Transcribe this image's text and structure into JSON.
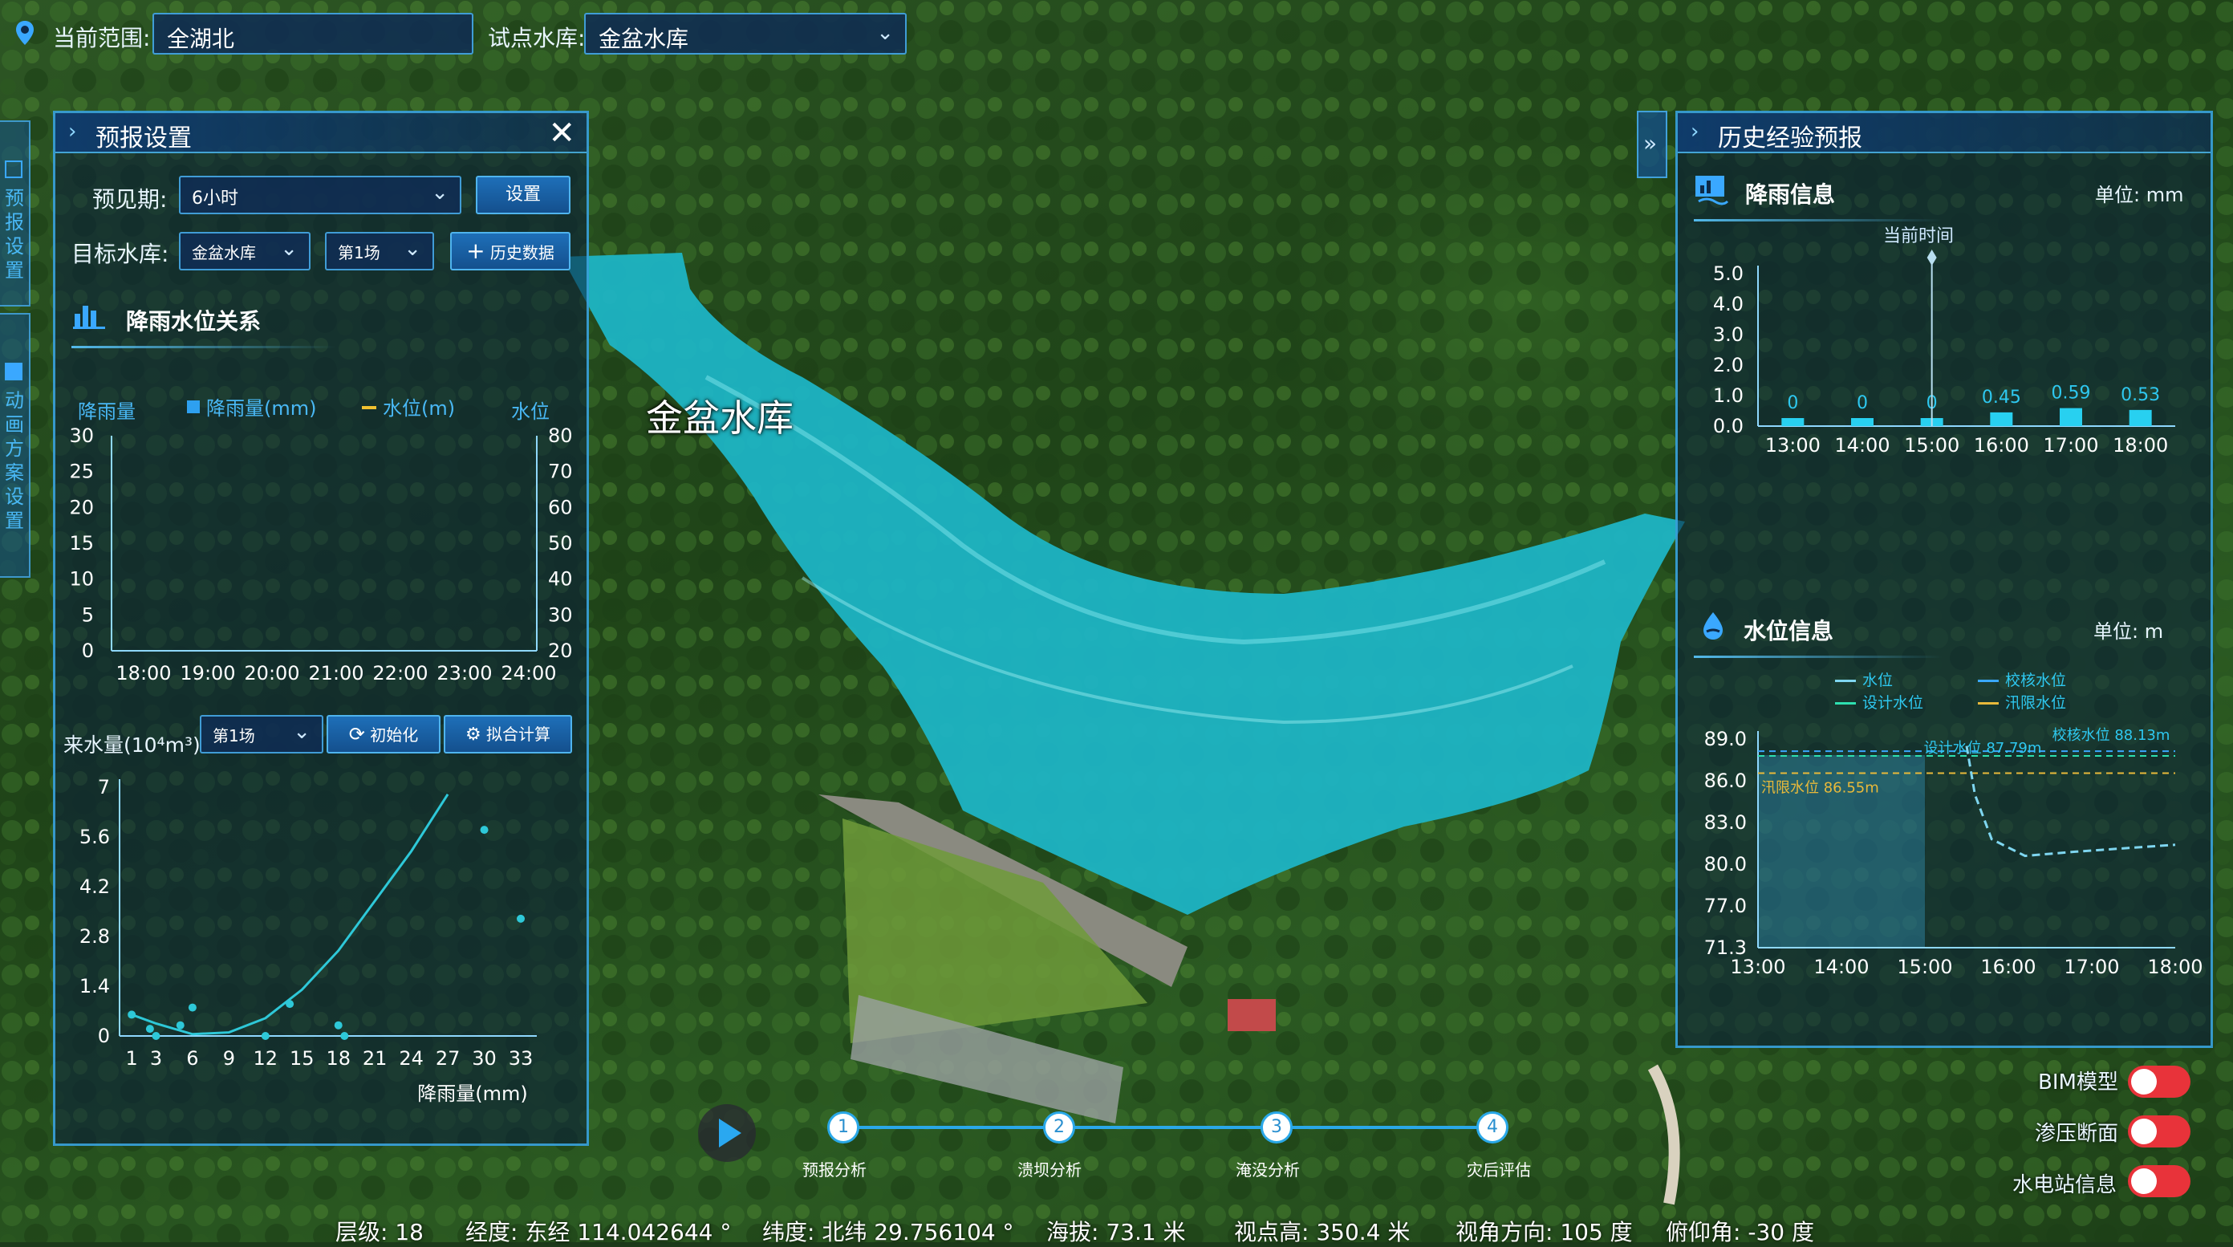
{
  "topbar": {
    "scope_label": "当前范围:",
    "scope_value": "全湖北",
    "reservoir_label": "试点水库:",
    "reservoir_value": "金盆水库"
  },
  "left_tabs": [
    "预报设置",
    "动画方案设置"
  ],
  "map_label": "金盆水库",
  "forecast_panel": {
    "title": "预报设置",
    "period_label": "预见期:",
    "period_value": "6小时",
    "set_button": "设置",
    "target_label": "目标水库:",
    "target_value": "金盆水库",
    "event_value": "第1场",
    "history_button": "历史数据",
    "relation_title": "降雨水位关系",
    "legend_left": "降雨量",
    "legend_rain": "降雨量(mm)",
    "legend_level": "水位(m)",
    "legend_right": "水位",
    "inflow_label": "来水量(10⁴m³)",
    "inflow_event": "第1场",
    "init_button": "初始化",
    "fit_button": "拟合计算",
    "scatter_xlabel": "降雨量(mm)"
  },
  "history_panel": {
    "title": "历史经验预报",
    "rain_title": "降雨信息",
    "rain_unit": "单位: mm",
    "current_time": "当前时间",
    "level_title": "水位信息",
    "level_unit": "单位: m",
    "legend": [
      "水位",
      "校核水位",
      "设计水位",
      "汛限水位"
    ],
    "design_label": "设计水位 87.79m",
    "check_label": "校核水位 88.13m",
    "flood_label": "汛限水位 86.55m"
  },
  "toggles": [
    "BIM模型",
    "渗压断面",
    "水电站信息"
  ],
  "steps": [
    {
      "num": "1",
      "label": "预报分析"
    },
    {
      "num": "2",
      "label": "溃坝分析"
    },
    {
      "num": "3",
      "label": "淹没分析"
    },
    {
      "num": "4",
      "label": "灾后评估"
    }
  ],
  "status": {
    "level": "层级: 18",
    "lon": "经度: 东经 114.042644 °",
    "lat": "纬度: 北纬 29.756104 °",
    "alt": "海拔: 73.1 米",
    "view_height": "视点高: 350.4 米",
    "heading": "视角方向: 105 度",
    "pitch": "俯仰角: -30 度"
  },
  "chart_data": [
    {
      "type": "line",
      "title": "降雨水位关系",
      "x": [
        "18:00",
        "19:00",
        "20:00",
        "21:00",
        "22:00",
        "23:00",
        "24:00"
      ],
      "ylabel_left": "降雨量",
      "ylabel_right": "水位",
      "left_ticks": [
        "30",
        "25",
        "20",
        "15",
        "10",
        "5",
        "0"
      ],
      "right_ticks": [
        "80",
        "70",
        "60",
        "50",
        "40",
        "30",
        "20"
      ],
      "ylim_left": [
        0,
        30
      ],
      "ylim_right": [
        20,
        80
      ],
      "series": [
        {
          "name": "降雨量(mm)",
          "values": []
        },
        {
          "name": "水位(m)",
          "values": []
        }
      ]
    },
    {
      "type": "scatter",
      "xlabel": "降雨量(mm)",
      "ylabel": "来水量(10⁴m³)",
      "x_ticks": [
        "1",
        "3",
        "6",
        "9",
        "12",
        "15",
        "18",
        "21",
        "24",
        "27",
        "30",
        "33"
      ],
      "y_ticks": [
        "7",
        "5.6",
        "4.2",
        "2.8",
        "1.4",
        "0"
      ],
      "xlim": [
        0,
        33
      ],
      "ylim": [
        0,
        7
      ],
      "points": [
        [
          1,
          0.6
        ],
        [
          2.5,
          0.2
        ],
        [
          3,
          0.0
        ],
        [
          5,
          0.3
        ],
        [
          6,
          0.8
        ],
        [
          12,
          0.0
        ],
        [
          14,
          0.9
        ],
        [
          18,
          0.3
        ],
        [
          18.5,
          0.0
        ],
        [
          30,
          5.8
        ],
        [
          33,
          3.3
        ]
      ],
      "fit_curve": [
        [
          1,
          0.6
        ],
        [
          3,
          0.35
        ],
        [
          6,
          0.05
        ],
        [
          9,
          0.1
        ],
        [
          12,
          0.5
        ],
        [
          15,
          1.3
        ],
        [
          18,
          2.4
        ],
        [
          21,
          3.8
        ],
        [
          24,
          5.2
        ],
        [
          27,
          6.8
        ]
      ]
    },
    {
      "type": "bar",
      "title": "降雨信息",
      "categories": [
        "13:00",
        "14:00",
        "15:00",
        "16:00",
        "17:00",
        "18:00"
      ],
      "values": [
        0,
        0,
        0,
        0.45,
        0.59,
        0.53
      ],
      "value_labels": [
        "0",
        "0",
        "0",
        "0.45",
        "0.59",
        "0.53"
      ],
      "y_ticks": [
        "5.0",
        "4.0",
        "3.0",
        "2.0",
        "1.0",
        "0.0"
      ],
      "ylim": [
        0,
        5
      ],
      "current_time": "15:00"
    },
    {
      "type": "line",
      "title": "水位信息",
      "x": [
        "13:00",
        "14:00",
        "15:00",
        "16:00",
        "17:00",
        "18:00"
      ],
      "y_ticks": [
        "89.0",
        "86.0",
        "83.0",
        "80.0",
        "77.0",
        "71.3"
      ],
      "ylim": [
        71.3,
        89
      ],
      "series": [
        {
          "name": "水位",
          "points": [
            [
              15.5,
              88.5
            ],
            [
              15.6,
              85.0
            ],
            [
              15.8,
              81.8
            ],
            [
              16.2,
              80.6
            ],
            [
              16.8,
              80.9
            ],
            [
              18.0,
              81.4
            ]
          ]
        },
        {
          "name": "校核水位",
          "value": 88.13
        },
        {
          "name": "设计水位",
          "value": 87.79
        },
        {
          "name": "汛限水位",
          "value": 86.55
        }
      ]
    }
  ],
  "colors": {
    "accent": "#2ec8f0",
    "panel_border": "#3caae6",
    "toggle_on": "#e8333a",
    "flood_limit": "#e8b93a"
  }
}
